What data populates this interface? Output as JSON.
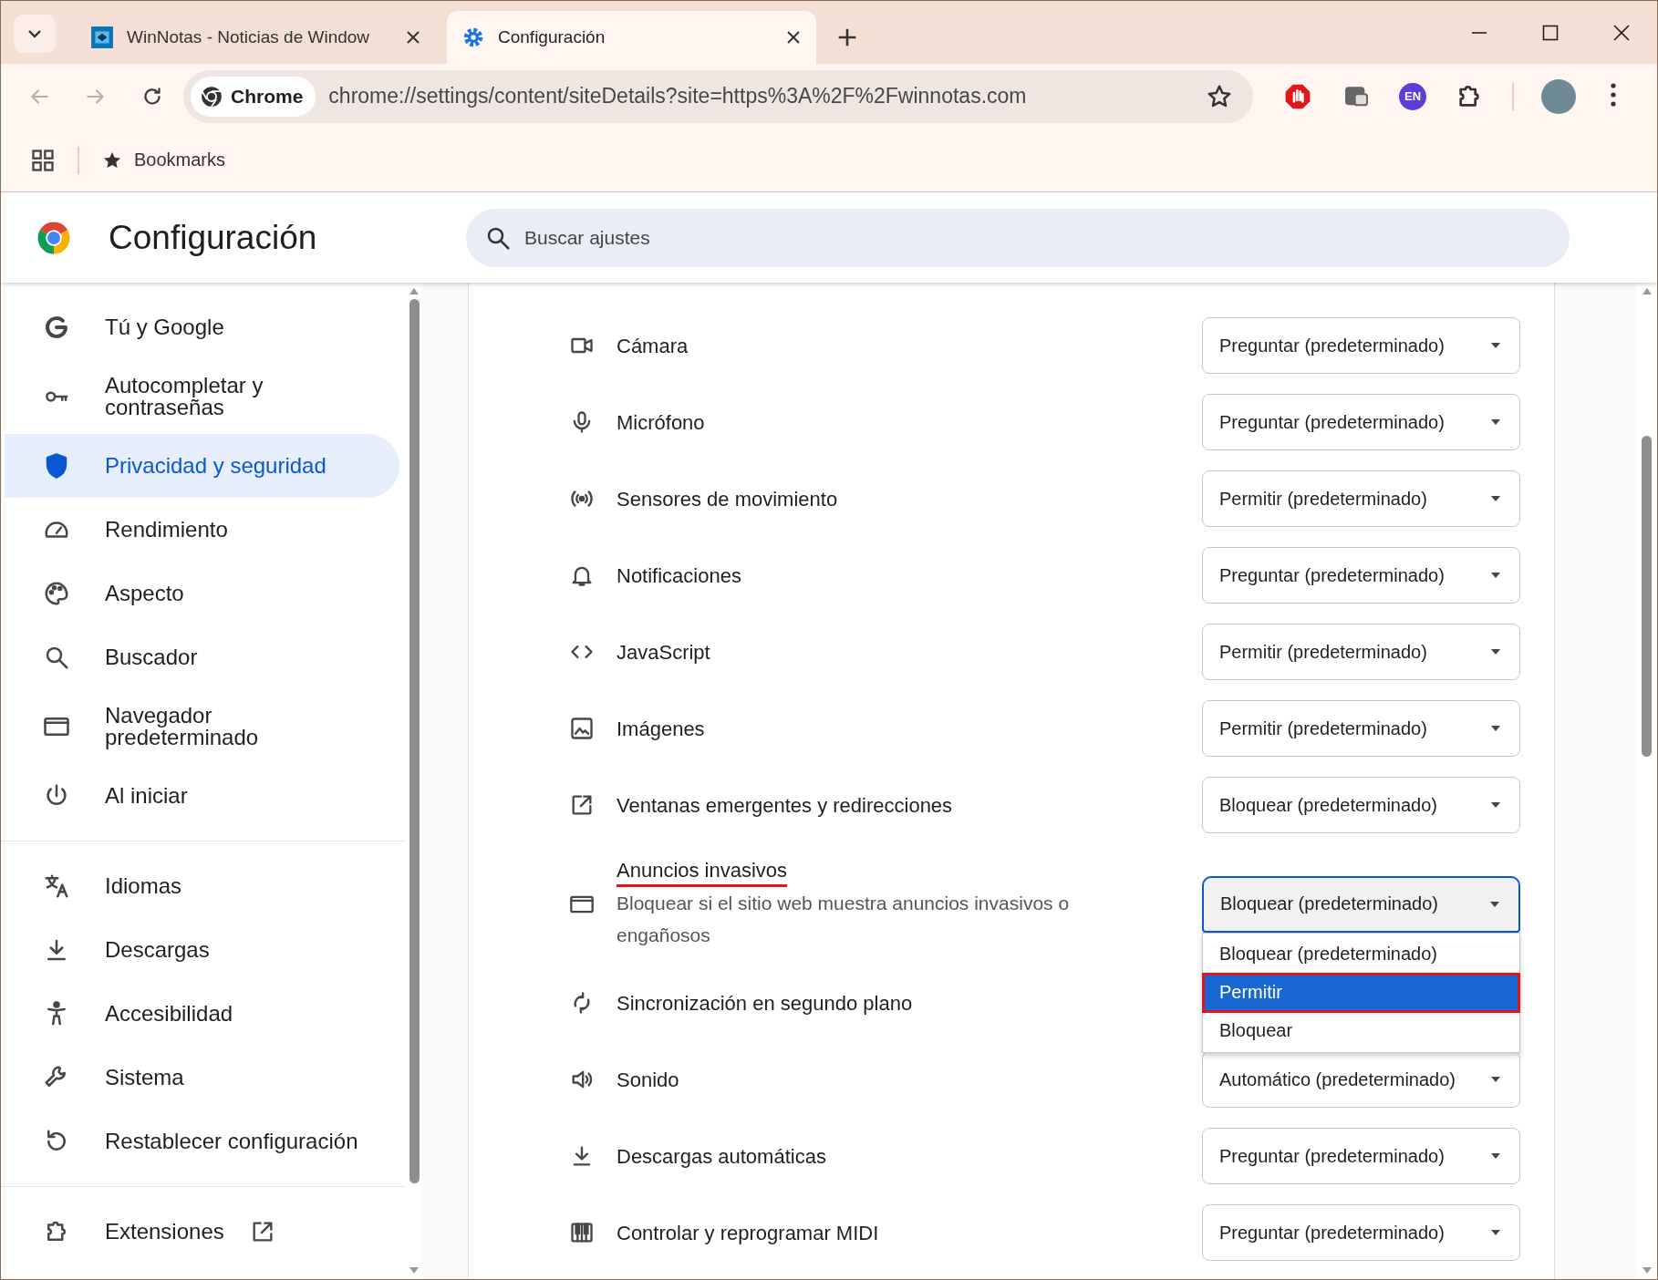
{
  "tab_strip": {
    "tabs": [
      {
        "title": "WinNotas - Noticias de Window",
        "selected": false
      },
      {
        "title": "Configuración",
        "selected": true
      }
    ]
  },
  "toolbar": {
    "nav": [
      {
        "kind": "back",
        "disabled": true
      },
      {
        "kind": "forward",
        "disabled": true
      },
      {
        "kind": "reload",
        "disabled": false
      }
    ],
    "address": {
      "chip": "Chrome",
      "url": "chrome://settings/content/siteDetails?site=https%3A%2F%2Fwinnotas.com"
    },
    "extensions": [
      {
        "kind": "stop"
      },
      {
        "kind": "cast"
      },
      {
        "kind": "badge",
        "text": "EN"
      },
      {
        "kind": "puzzle"
      },
      {
        "kind": "avatar"
      }
    ]
  },
  "bookmarks_bar": {
    "label": "Bookmarks"
  },
  "settings_header": {
    "title": "Configuración",
    "search": {
      "placeholder": "Buscar ajustes"
    }
  },
  "sidebar": {
    "sections": [
      {
        "items": [
          {
            "label": "Tú y Google",
            "selected": false
          },
          {
            "label": "Autocompletar y contraseñas",
            "selected": false
          },
          {
            "label": "Privacidad y seguridad",
            "selected": true
          },
          {
            "label": "Rendimiento",
            "selected": false
          },
          {
            "label": "Aspecto",
            "selected": false
          },
          {
            "label": "Buscador",
            "selected": false
          },
          {
            "label": "Navegador predeterminado",
            "selected": false
          },
          {
            "label": "Al iniciar",
            "selected": false
          }
        ]
      },
      {
        "items": [
          {
            "label": "Idiomas",
            "selected": false
          },
          {
            "label": "Descargas",
            "selected": false
          },
          {
            "label": "Accesibilidad",
            "selected": false
          },
          {
            "label": "Sistema",
            "selected": false
          },
          {
            "label": "Restablecer configuración",
            "selected": false
          }
        ]
      },
      {
        "items": [
          {
            "label": "Extensiones",
            "selected": false
          }
        ]
      }
    ]
  },
  "permissions": [
    {
      "label": "Cámara",
      "value": "Preguntar (predeterminado)"
    },
    {
      "label": "Micrófono",
      "value": "Preguntar (predeterminado)"
    },
    {
      "label": "Sensores de movimiento",
      "value": "Permitir (predeterminado)"
    },
    {
      "label": "Notificaciones",
      "value": "Preguntar (predeterminado)"
    },
    {
      "label": "JavaScript",
      "value": "Permitir (predeterminado)"
    },
    {
      "label": "Imágenes",
      "value": "Permitir (predeterminado)"
    },
    {
      "label": "Ventanas emergentes y redirecciones",
      "value": "Bloquear (predeterminado)"
    },
    {
      "label": "Anuncios invasivos",
      "underlined": true,
      "description": "Bloquear si el sitio web muestra anuncios invasivos o engañosos",
      "value": "Bloquear (predeterminado)",
      "open": true,
      "menu": [
        {
          "label": "Bloquear (predeterminado)",
          "highlighted": false,
          "marked": false
        },
        {
          "label": "Permitir",
          "highlighted": true,
          "marked": true
        },
        {
          "label": "Bloquear",
          "highlighted": false,
          "marked": false
        }
      ]
    },
    {
      "label": "Sincronización en segundo plano"
    },
    {
      "label": "Sonido",
      "value": "Automático (predeterminado)"
    },
    {
      "label": "Descargas automáticas",
      "value": "Preguntar (predeterminado)"
    },
    {
      "label": "Controlar y reprogramar MIDI",
      "value": "Preguntar (predeterminado)"
    }
  ]
}
